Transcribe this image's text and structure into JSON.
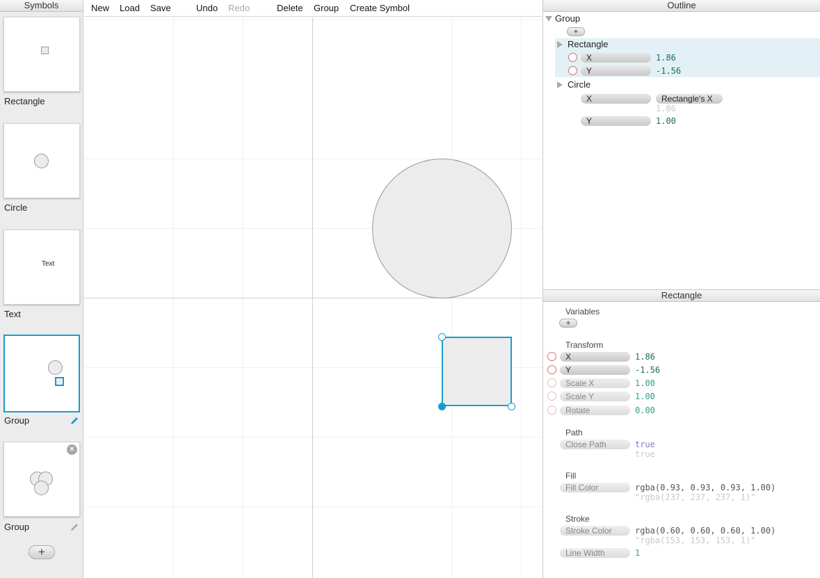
{
  "sidebar": {
    "title": "Symbols",
    "symbols": [
      {
        "label": "Rectangle",
        "preview": "rectangle",
        "text": ""
      },
      {
        "label": "Circle",
        "preview": "circle",
        "text": ""
      },
      {
        "label": "Text",
        "preview": "text",
        "text": "Text"
      },
      {
        "label": "Group",
        "preview": "group",
        "selected": true
      },
      {
        "label": "Group",
        "preview": "group-circles"
      }
    ],
    "add_label": "+",
    "close_label": "×"
  },
  "toolbar": {
    "new": "New",
    "load": "Load",
    "save": "Save",
    "undo": "Undo",
    "redo": "Redo",
    "delete": "Delete",
    "group": "Group",
    "create_symbol": "Create Symbol"
  },
  "outline": {
    "title": "Outline",
    "root": "Group",
    "add_label": "+",
    "rectangle": {
      "label": "Rectangle",
      "x_label": "X",
      "x_value": "1.86",
      "y_label": "Y",
      "y_value": "-1.56"
    },
    "circle": {
      "label": "Circle",
      "x_label": "X",
      "x_ref": "Rectangle's X",
      "x_value": "1.86",
      "y_label": "Y",
      "y_value": "1.00"
    }
  },
  "inspector": {
    "title": "Rectangle",
    "variables_label": "Variables",
    "add_label": "+",
    "transform": {
      "label": "Transform",
      "x_label": "X",
      "x_value": "1.86",
      "y_label": "Y",
      "y_value": "-1.56",
      "scale_x_label": "Scale X",
      "scale_x_value": "1.00",
      "scale_y_label": "Scale Y",
      "scale_y_value": "1.00",
      "rotate_label": "Rotate",
      "rotate_value": "0.00"
    },
    "path": {
      "label": "Path",
      "close_path_label": "Close Path",
      "close_path_value": "true",
      "close_path_eval": "true"
    },
    "fill": {
      "label": "Fill",
      "fill_color_label": "Fill Color",
      "fill_color_value": "rgba(0.93, 0.93, 0.93, 1.00)",
      "fill_color_eval": "\"rgba(237, 237, 237, 1)\""
    },
    "stroke": {
      "label": "Stroke",
      "stroke_color_label": "Stroke Color",
      "stroke_color_value": "rgba(0.60, 0.60, 0.60, 1.00)",
      "stroke_color_eval": "\"rgba(153, 153, 153, 1)\"",
      "line_width_label": "Line Width",
      "line_width_value": "1"
    }
  },
  "colors": {
    "accent": "#1a9bd1",
    "shape_fill": "#ececec",
    "shape_stroke": "#999999",
    "highlight": "#e3f1f7"
  }
}
